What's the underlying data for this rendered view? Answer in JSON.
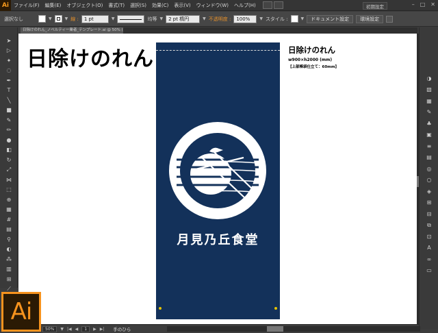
{
  "app": {
    "logo": "Ai",
    "badge": "Ai",
    "accent": "#f7931e"
  },
  "menu": {
    "items": [
      "ファイル(F)",
      "編集(E)",
      "オブジェクト(O)",
      "書式(T)",
      "選択(S)",
      "効果(C)",
      "表示(V)",
      "ウィンドウ(W)",
      "ヘルプ(H)"
    ],
    "workspace": "初期設定"
  },
  "control": {
    "selection": "選択なし",
    "stroke_label": "線 :",
    "stroke_weight": "1 pt",
    "line_style": "均等",
    "brush": "2 pt 楕円",
    "opacity_label": "不透明度 :",
    "opacity_value": "100%",
    "style_label": "スタイル :",
    "document_settings": "ドキュメント設定",
    "preferences": "環境設定"
  },
  "tab": {
    "label": "日除けのれん_ノベルティー業者_テンプレート.ai @ 50% (CMYK/プレビュー)"
  },
  "artboard": {
    "title": "日除けのれん",
    "info_title": "日除けのれん",
    "info_size": "w900×h2000 (mm)",
    "info_note": "【上部棒袋仕立て：60mm】",
    "shop_name": "月見乃丘食堂",
    "noren_color": "#13315a"
  },
  "status": {
    "zoom": "50%",
    "page": "1",
    "tool": "手のひら"
  },
  "tools": [
    "selection-arrow-icon",
    "direct-selection-icon",
    "magic-wand-icon",
    "lasso-icon",
    "pen-icon",
    "type-icon",
    "line-icon",
    "rectangle-icon",
    "paintbrush-icon",
    "pencil-icon",
    "blob-brush-icon",
    "eraser-icon",
    "rotate-icon",
    "scale-icon",
    "width-icon",
    "free-transform-icon",
    "shape-builder-icon",
    "perspective-icon",
    "mesh-icon",
    "gradient-icon",
    "eyedropper-icon",
    "blend-icon",
    "symbol-sprayer-icon",
    "column-graph-icon",
    "artboard-icon",
    "slice-icon",
    "hand-icon",
    "zoom-icon"
  ],
  "panels": [
    "color-icon",
    "color-guide-icon",
    "swatches-icon",
    "brushes-icon",
    "symbols-icon",
    "graphic-styles-icon",
    "stroke-icon",
    "gradient-panel-icon",
    "transparency-icon",
    "appearance-icon",
    "layers-icon",
    "artboards-icon",
    "align-icon",
    "pathfinder-icon",
    "transform-icon",
    "character-icon",
    "links-icon",
    "navigator-icon"
  ]
}
